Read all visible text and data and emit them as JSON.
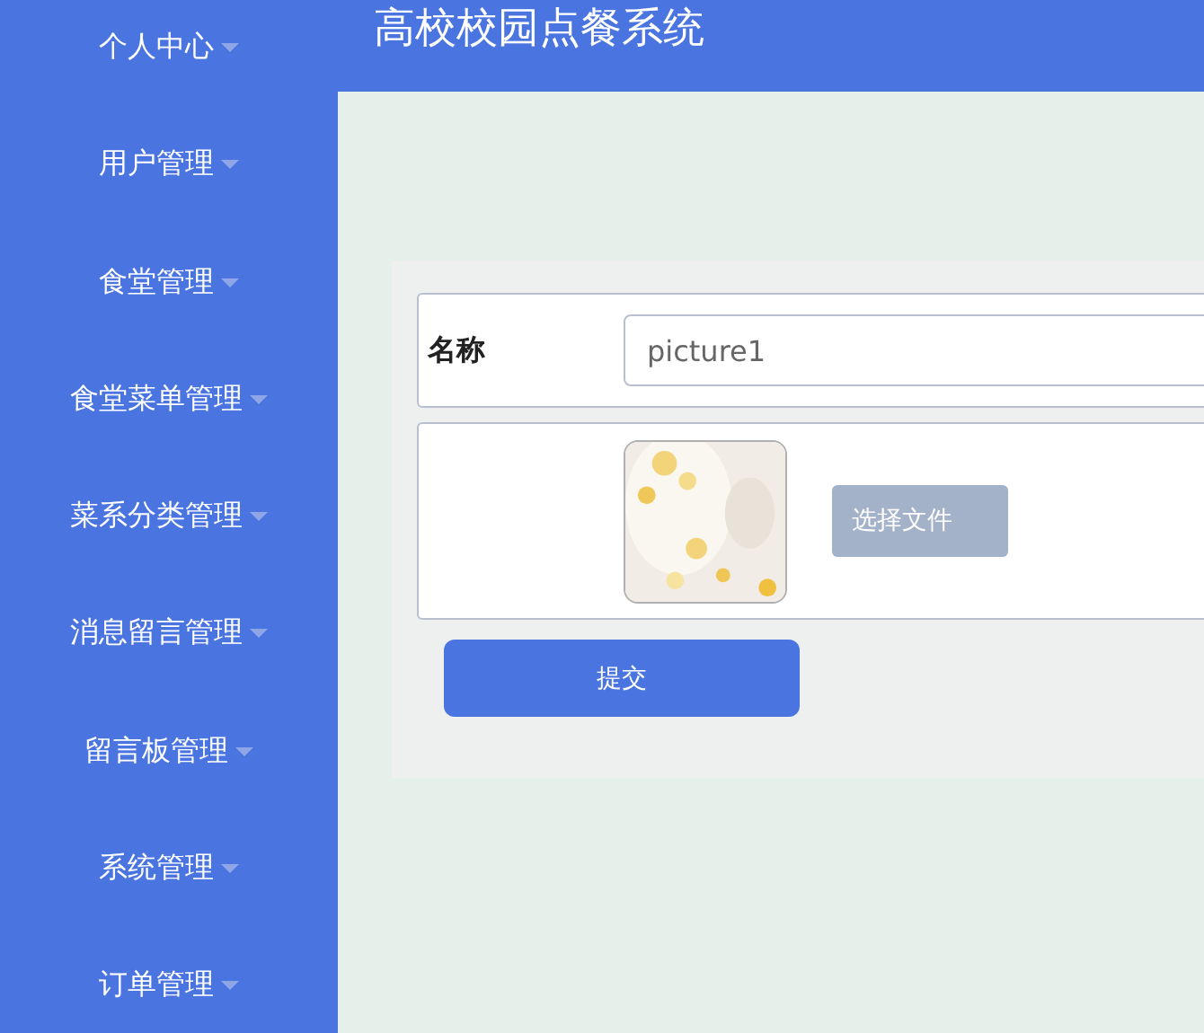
{
  "sidebar": {
    "items": [
      {
        "label": "个人中心"
      },
      {
        "label": "用户管理"
      },
      {
        "label": "食堂管理"
      },
      {
        "label": "食堂菜单管理"
      },
      {
        "label": "菜系分类管理"
      },
      {
        "label": "消息留言管理"
      },
      {
        "label": "留言板管理"
      },
      {
        "label": "系统管理"
      },
      {
        "label": "订单管理"
      }
    ]
  },
  "header": {
    "title": "高校校园点餐系统"
  },
  "form": {
    "name_label": "名称",
    "name_value": "picture1",
    "upload_button": "选择文件",
    "submit_button": "提交"
  }
}
